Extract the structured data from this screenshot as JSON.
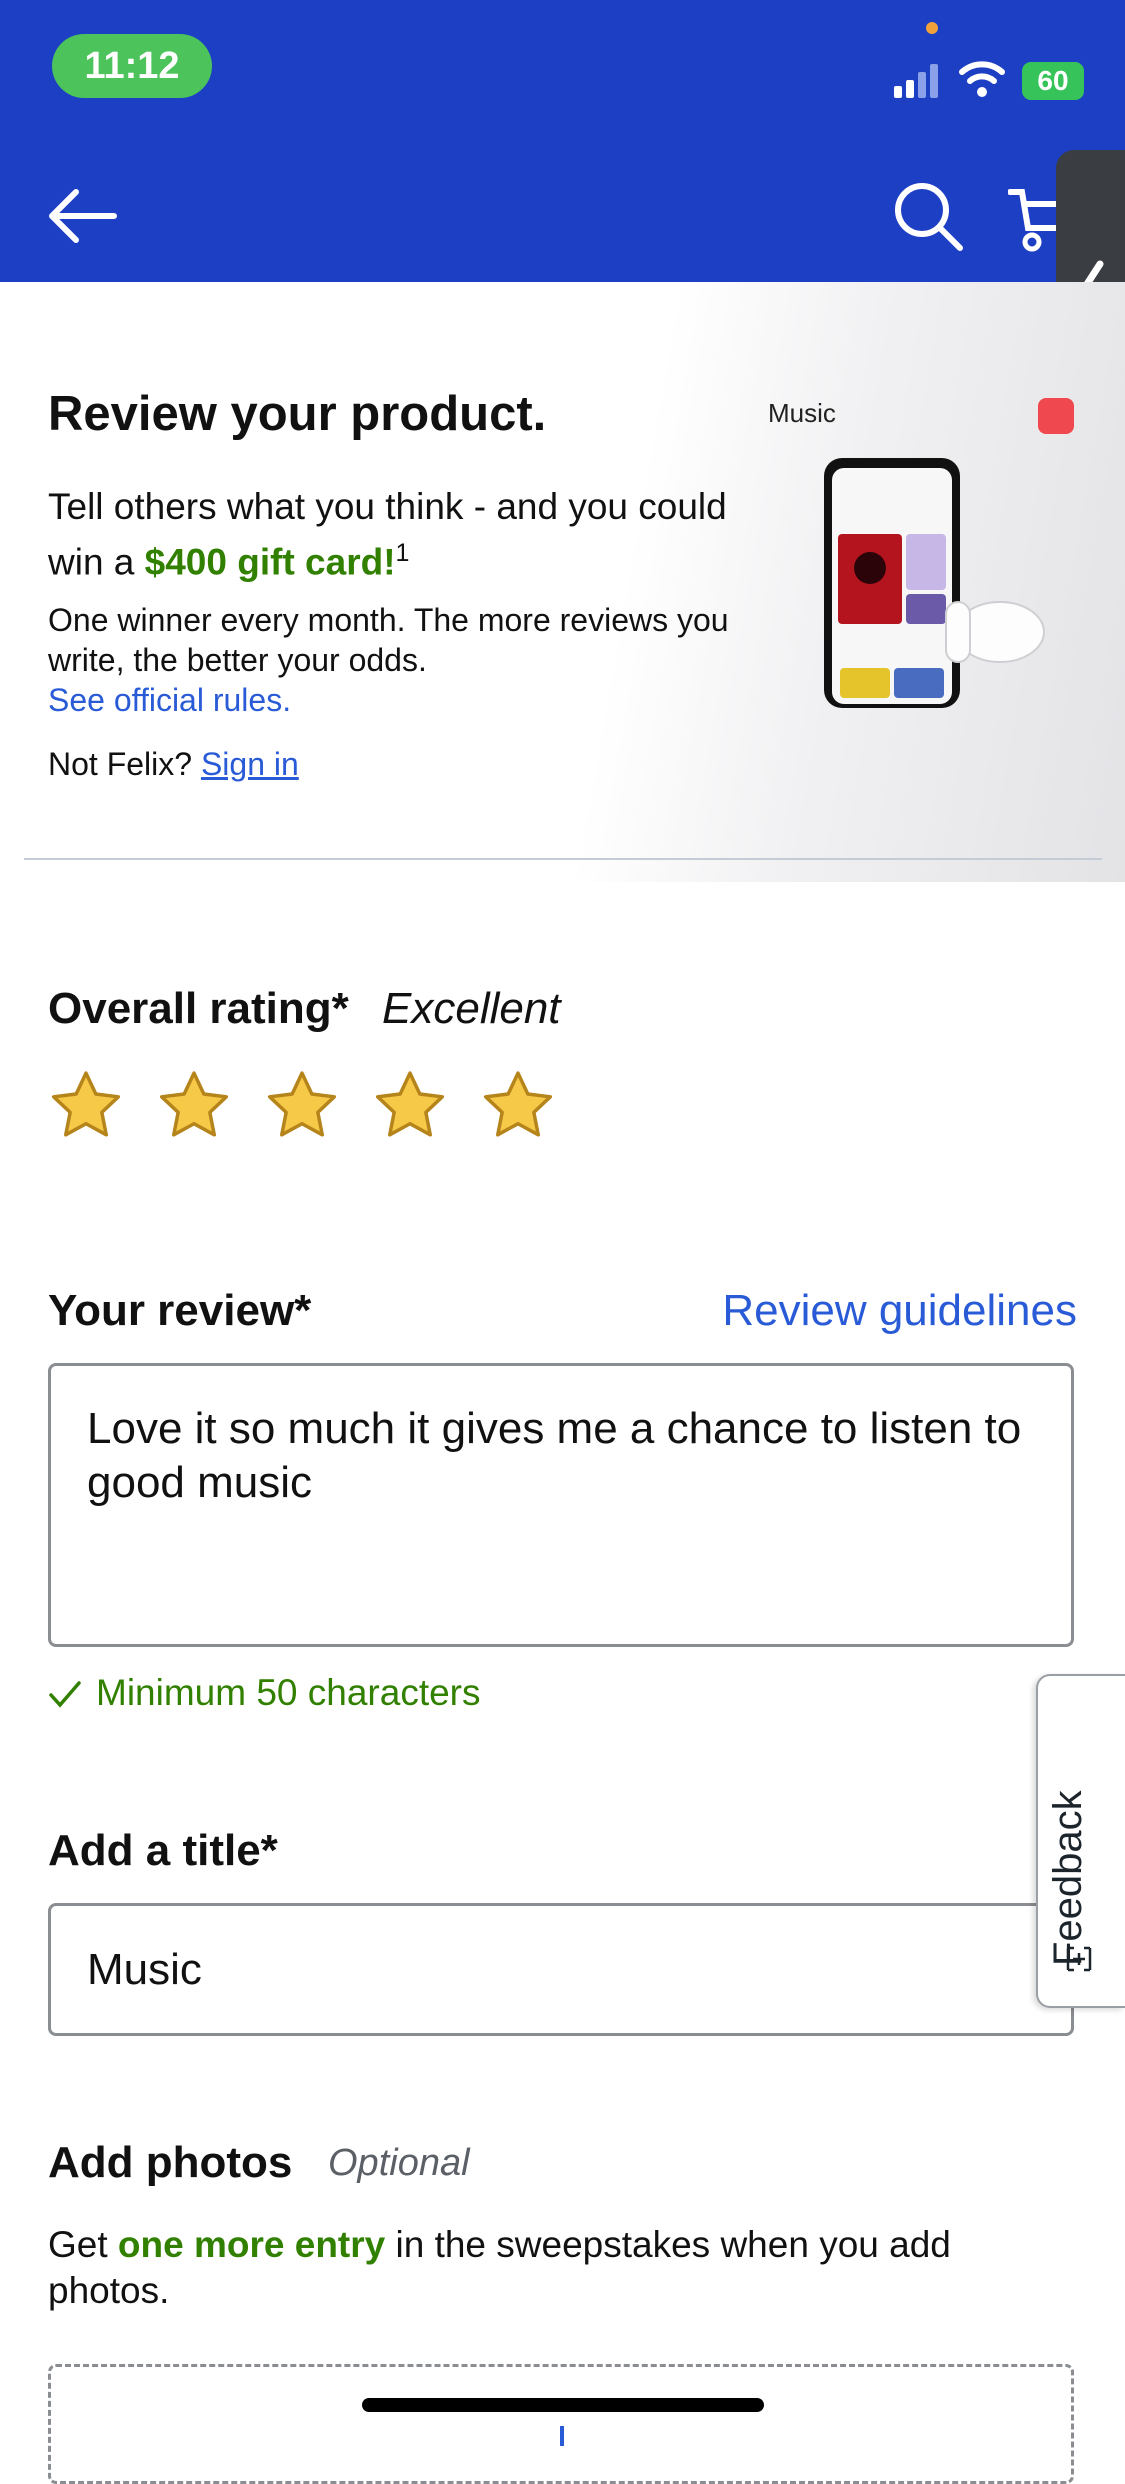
{
  "status_bar": {
    "time": "11:12",
    "battery": "60"
  },
  "hero": {
    "title": "Review your product.",
    "subtitle_before": "Tell others what you think - and you could win a ",
    "subtitle_highlight": "$400 gift card!",
    "subtitle_footnote": "1",
    "note": "One winner every month. The more reviews you write, the better your odds.",
    "rules_link": "See official rules.",
    "not_user": "Not Felix?",
    "sign_in": "Sign in",
    "product_brand": "Music"
  },
  "rating": {
    "label": "Overall rating*",
    "value_text": "Excellent",
    "stars": 5,
    "max_stars": 5,
    "star_color": "#f7c948"
  },
  "review": {
    "label": "Your review*",
    "guidelines_link": "Review guidelines",
    "text": "Love it so much it gives me a chance to listen to good music",
    "validation": "Minimum 50 characters"
  },
  "title_field": {
    "label": "Add a title*",
    "value": "Music"
  },
  "photos": {
    "label": "Add photos",
    "optional": "Optional",
    "desc_before": "Get ",
    "desc_highlight": "one more entry",
    "desc_after": " in the sweepstakes when you add photos."
  },
  "feedback_tab": {
    "label": "Feedback"
  },
  "colors": {
    "header": "#1d3fc4",
    "accent_green": "#318000",
    "link_blue": "#2a5bd7"
  }
}
